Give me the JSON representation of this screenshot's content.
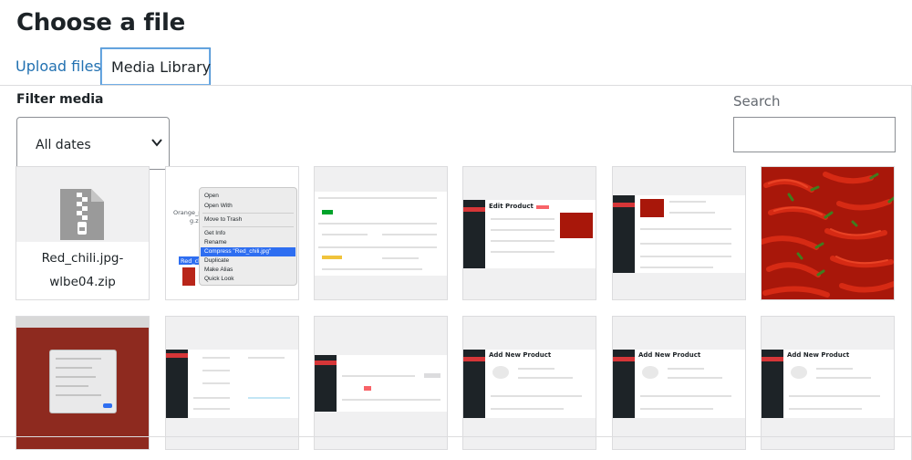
{
  "dialog": {
    "title": "Choose a file"
  },
  "tabs": [
    {
      "label": "Upload files",
      "active": false
    },
    {
      "label": "Media Library",
      "active": true
    }
  ],
  "filter": {
    "label": "Filter media",
    "date_select_value": "All dates"
  },
  "search": {
    "label": "Search",
    "value": ""
  },
  "media": {
    "zip_item": {
      "filename_line1": "Red_chili.jpg-",
      "filename_line2": "wlbe04.zip",
      "icon": "zip-file-icon"
    },
    "context_menu": {
      "filename_fragment": "Orange_p",
      "filename_fragment2": "g.zi",
      "selected_file_label": "Red_ch",
      "items": [
        "Open",
        "Open With",
        "Move to Trash",
        "Get Info",
        "Rename",
        "Compress \"Red_chili.jpg\"",
        "Duplicate",
        "Make Alias",
        "Quick Look"
      ]
    },
    "thumbs": {
      "edit_product_title": "Edit Product",
      "add_new_product_title": "Add New Product"
    }
  },
  "colors": {
    "link": "#2271b1",
    "focus": "#4f94d4",
    "admin_sidebar": "#1d2327",
    "accent_red": "#d63638",
    "pepper_red": "#a8170a"
  }
}
